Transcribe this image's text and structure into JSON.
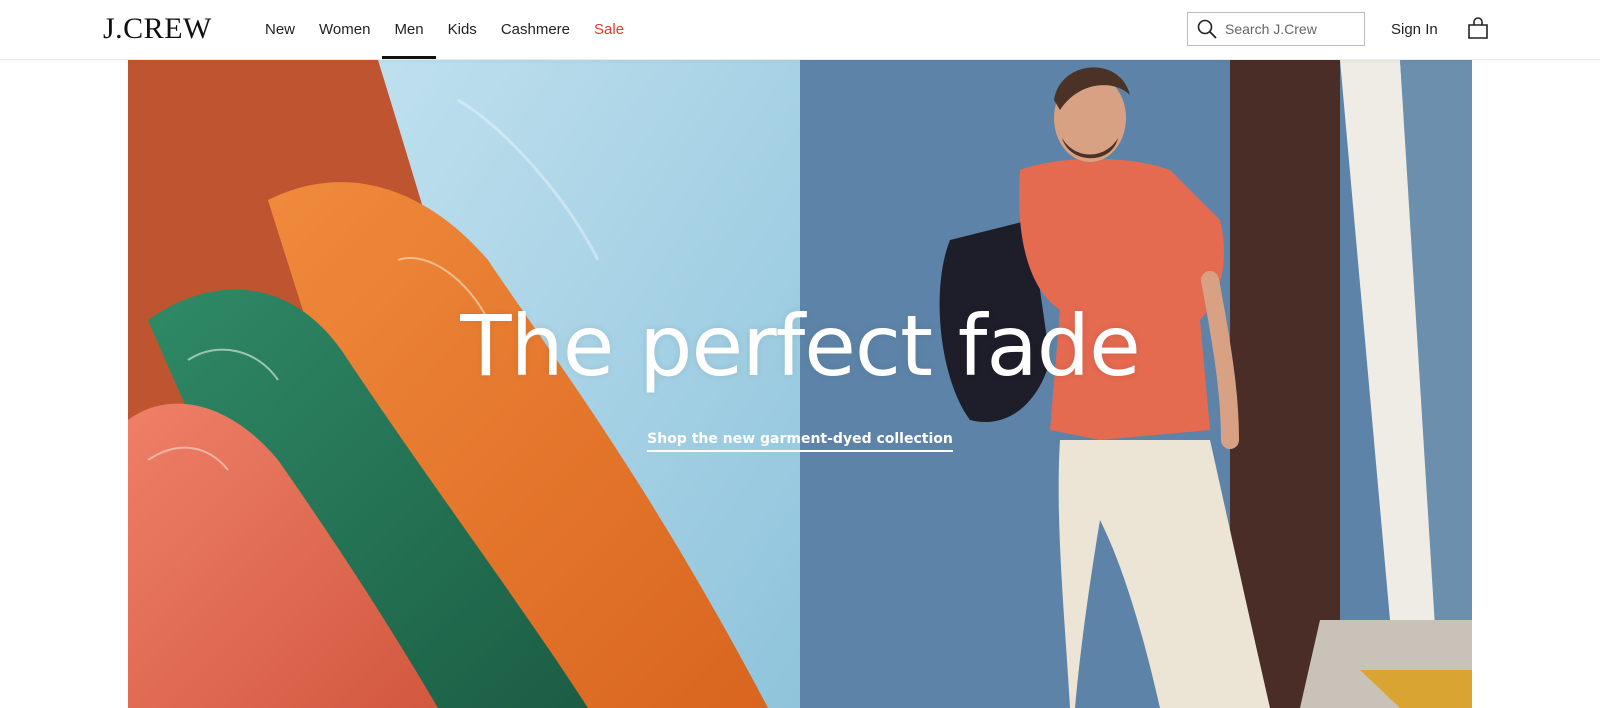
{
  "header": {
    "logo": "J.CREW",
    "nav": [
      {
        "label": "New"
      },
      {
        "label": "Women"
      },
      {
        "label": "Men"
      },
      {
        "label": "Kids"
      },
      {
        "label": "Cashmere"
      },
      {
        "label": "Sale"
      }
    ],
    "active_nav": "Men",
    "search": {
      "placeholder": "Search J.Crew",
      "value": ""
    },
    "sign_in": "Sign In",
    "bag_icon": "shopping-bag-icon",
    "search_icon": "search-icon"
  },
  "hero": {
    "title": "The perfect fade",
    "cta": "Shop the new garment-dyed collection",
    "colors": {
      "sale": "#e4392f",
      "left_bg": "#c2552f",
      "right_bg": "#5b82a6"
    }
  }
}
